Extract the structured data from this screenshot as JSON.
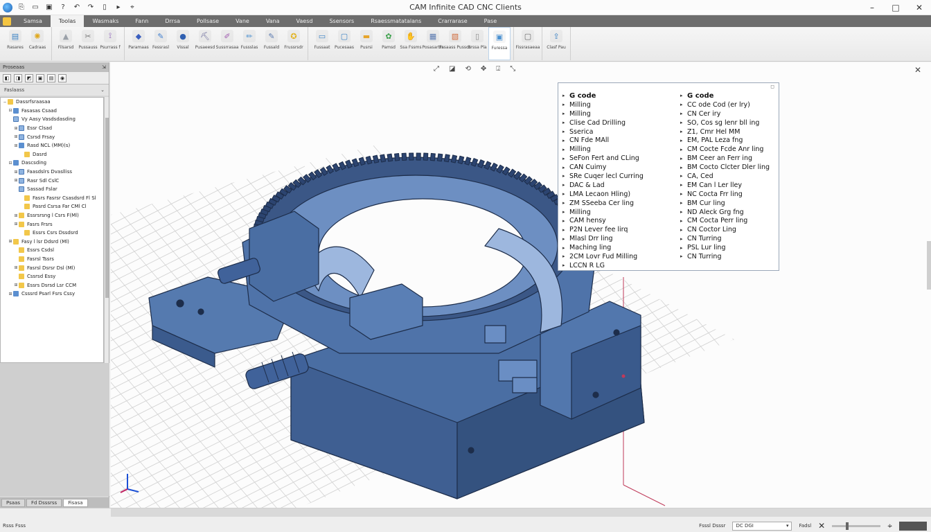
{
  "window": {
    "title": "CAM Infinite CAD CNC Clients",
    "controls": [
      "–",
      "□",
      "✕"
    ]
  },
  "quick_access": [
    {
      "icon": "app-logo-icon",
      "glyph": ""
    },
    {
      "icon": "copy-icon",
      "glyph": "⎘"
    },
    {
      "icon": "open-folder-icon",
      "glyph": "▭"
    },
    {
      "icon": "save-icon",
      "glyph": "▣"
    },
    {
      "icon": "help-icon",
      "glyph": "?"
    },
    {
      "icon": "undo-icon",
      "glyph": "↶"
    },
    {
      "icon": "redo-icon",
      "glyph": "↷"
    },
    {
      "icon": "page-icon",
      "glyph": "▯"
    },
    {
      "icon": "arrow-icon",
      "glyph": "▸"
    },
    {
      "icon": "pin-icon",
      "glyph": "⌖"
    }
  ],
  "ribbon_tabs": [
    "Samsa",
    "Toolas",
    "Wasmaks",
    "Fann",
    "Drrsa",
    "Pollsase",
    "Vane",
    "Vana",
    "Vaesd",
    "Ssensors",
    "Rsaessmatatalans",
    "Crarrarase",
    "Pase"
  ],
  "ribbon_active_tab": 1,
  "ribbon_groups": [
    [
      {
        "label": "Rasares",
        "icon": "document-icon",
        "glyph": "▤",
        "color": "#3b82c4"
      },
      {
        "label": "Cadraas",
        "icon": "gear-yellow-icon",
        "glyph": "✺",
        "color": "#e0a81c"
      }
    ],
    [
      {
        "label": "Filsarsd",
        "icon": "cone-icon",
        "glyph": "▲",
        "color": "#9aa0a8"
      },
      {
        "label": "Pussauss",
        "icon": "tool-icon",
        "glyph": "✂",
        "color": "#7a7a7a"
      },
      {
        "label": "Psurrass f",
        "icon": "bracket-icon",
        "glyph": "⟟",
        "color": "#8b5bb8"
      }
    ],
    [
      {
        "label": "Paramaas",
        "icon": "toolpath-icon",
        "glyph": "◆",
        "color": "#3b5fbf"
      },
      {
        "label": "Fessrasl",
        "icon": "pen-icon",
        "glyph": "✎",
        "color": "#3f7fd0"
      },
      {
        "label": "Vissal",
        "icon": "sphere-icon",
        "glyph": "●",
        "color": "#2f5fb0"
      },
      {
        "label": "Pusaeesd",
        "icon": "mill-icon",
        "glyph": "⛏",
        "color": "#6a6a9a"
      },
      {
        "label": "Sussrrasaa",
        "icon": "drill-icon",
        "glyph": "✐",
        "color": "#a05bb0"
      },
      {
        "label": "Fussslas",
        "icon": "brush-icon",
        "glyph": "✏",
        "color": "#4a90d0"
      },
      {
        "label": "Fussald",
        "icon": "pencil-icon",
        "glyph": "✎",
        "color": "#5a7ab0"
      },
      {
        "label": "Frussrsdr",
        "icon": "bulb-icon",
        "glyph": "✪",
        "color": "#e2b21d"
      }
    ],
    [
      {
        "label": "Fussaat",
        "icon": "monitor-icon",
        "glyph": "▭",
        "color": "#3b82c4"
      },
      {
        "label": "Pucesaas",
        "icon": "window-icon",
        "glyph": "▢",
        "color": "#3b82c4"
      },
      {
        "label": "Pusrsi",
        "icon": "folder-icon",
        "glyph": "▬",
        "color": "#e6a42a"
      },
      {
        "label": "Pamsd",
        "icon": "leaf-icon",
        "glyph": "✿",
        "color": "#3aa04a"
      },
      {
        "label": "Ssa Fssms",
        "icon": "hand-icon",
        "glyph": "✋",
        "color": "#e0b030"
      },
      {
        "label": "Posasartrs",
        "icon": "grid-icon",
        "glyph": "▦",
        "color": "#5a7ab0"
      },
      {
        "label": "Fasaass Pussos",
        "icon": "box-icon",
        "glyph": "▧",
        "color": "#d06a3a"
      },
      {
        "label": "Brssa Pla",
        "icon": "page-white-icon",
        "glyph": "▯",
        "color": "#8a8a8a"
      },
      {
        "label": "Furessa",
        "icon": "dialog-icon",
        "glyph": "▣",
        "color": "#4a90d0"
      }
    ],
    [
      {
        "label": "Fissrasaeaa",
        "icon": "square-icon",
        "glyph": "▢",
        "color": "#6a6a6a"
      }
    ],
    [
      {
        "label": "Clasf Pau",
        "icon": "export-icon",
        "glyph": "⇪",
        "color": "#3b82c4"
      }
    ]
  ],
  "left_panel": {
    "header": "Proseaas",
    "tab_title": "Faslaass",
    "tools": [
      "◧",
      "◨",
      "◩",
      "▣",
      "▤",
      "◉"
    ],
    "tree": [
      {
        "label": "Dassrfsraasaa",
        "indent": 0,
        "expand": "−",
        "type": "folder"
      },
      {
        "label": "Fasasas Csaad",
        "indent": 1,
        "expand": "⊟",
        "type": "part"
      },
      {
        "label": "Vy Aasy Vasdsdasding",
        "indent": 1,
        "expand": "",
        "type": "op"
      },
      {
        "label": "Essr Clsad",
        "indent": 2,
        "expand": "⊞",
        "type": "op"
      },
      {
        "label": "Csrsd Frsay",
        "indent": 2,
        "expand": "⊞",
        "type": "op"
      },
      {
        "label": "Rasd NCL (MM)(s)",
        "indent": 2,
        "expand": "⊞",
        "type": "part"
      },
      {
        "label": "Dasrd",
        "indent": 3,
        "expand": "",
        "type": "folder"
      },
      {
        "label": "Dascsding",
        "indent": 1,
        "expand": "⊟",
        "type": "part"
      },
      {
        "label": "Faasdslrs Dvaslliss",
        "indent": 2,
        "expand": "⊞",
        "type": "op"
      },
      {
        "label": "Rasr Sdl CslC",
        "indent": 2,
        "expand": "⊞",
        "type": "op"
      },
      {
        "label": "Sassad Fslar",
        "indent": 2,
        "expand": "",
        "type": "op"
      },
      {
        "label": "Fasrs Fasrsr Csasdsrd Fl Sl",
        "indent": 3,
        "expand": "",
        "type": "folder"
      },
      {
        "label": "Pasrd Csrsa Far CMl Cl",
        "indent": 3,
        "expand": "",
        "type": "folder"
      },
      {
        "label": "Essrsrsng l Csrs F(Ml)",
        "indent": 2,
        "expand": "⊞",
        "type": "folder"
      },
      {
        "label": "Fasrs Frsrs",
        "indent": 2,
        "expand": "⊞",
        "type": "folder"
      },
      {
        "label": "Essrs Csrs Dssdsrd",
        "indent": 3,
        "expand": "",
        "type": "folder"
      },
      {
        "label": "Fasy l lsr Ddsrd (Ml)",
        "indent": 1,
        "expand": "⊞",
        "type": "folder"
      },
      {
        "label": "Essrs Csdsl",
        "indent": 2,
        "expand": "",
        "type": "folder"
      },
      {
        "label": "Fasrsl Tssrs",
        "indent": 2,
        "expand": "",
        "type": "folder"
      },
      {
        "label": "Fasrsl Dsrsr Dsl (Ml)",
        "indent": 2,
        "expand": "⊞",
        "type": "folder"
      },
      {
        "label": "Cssrsd Essy",
        "indent": 2,
        "expand": "",
        "type": "folder"
      },
      {
        "label": "Essrs Dsrsd Lsr CCM",
        "indent": 2,
        "expand": "⊞",
        "type": "folder"
      },
      {
        "label": "Csssrd Psarl Fsrs Cssy",
        "indent": 1,
        "expand": "⊞",
        "type": "part"
      }
    ],
    "bottom_tabs": [
      "Psaas",
      "Fd Dsssrss",
      "Fisasa"
    ]
  },
  "viewport": {
    "tools": [
      "⤢",
      "◪",
      "⟲",
      "✥",
      "⍗",
      "⤡"
    ],
    "close": "✕"
  },
  "overlay": {
    "close": "◻",
    "col1": [
      "G code",
      "Milling",
      "Milling",
      "Clise Cad Drilling",
      "Sserica",
      "CN Fde MAll",
      "Milling",
      "SeFon Fert and CLing",
      "CAN Cuimy",
      "SRe Cuqer lecl Curring",
      "DAC & Lad",
      "LMA Lecaon Hling)",
      "ZM SSeeba Cer ling",
      "Milling",
      "CAM hensy",
      "P2N Lever fee lirq",
      "Mlasl Drr ling",
      "Maching ling",
      "2CM Lovr Fud Milling",
      "LCCN R LG"
    ],
    "col2": [
      "G code",
      "CC ode Cod (er lry)",
      "CN Cer iry",
      "SO, Cos sg lenr bll ing",
      "Z1, Cmr Hel MM",
      "EM, PAL Leza fng",
      "CM Cocte Fcde Anr ling",
      "BM Ceer an Ferr ing",
      "BM Cocto Clcter Dler ling",
      "CA, Ced",
      "EM Can l Ler lley",
      "NC Cocta Frr ling",
      "BM Cur ling",
      "ND Aleck Grg fng",
      "CM Cocta Perr ling",
      "CN Coctor Ling",
      "CN Turring",
      "PSL Lur ling",
      "CN Turring"
    ]
  },
  "status": {
    "left": "Rsss Fsss",
    "label": "Fsssl Dsssr",
    "field": "DC DGI",
    "mode": "Fadsl",
    "icons": [
      "✕",
      "⌖"
    ]
  }
}
